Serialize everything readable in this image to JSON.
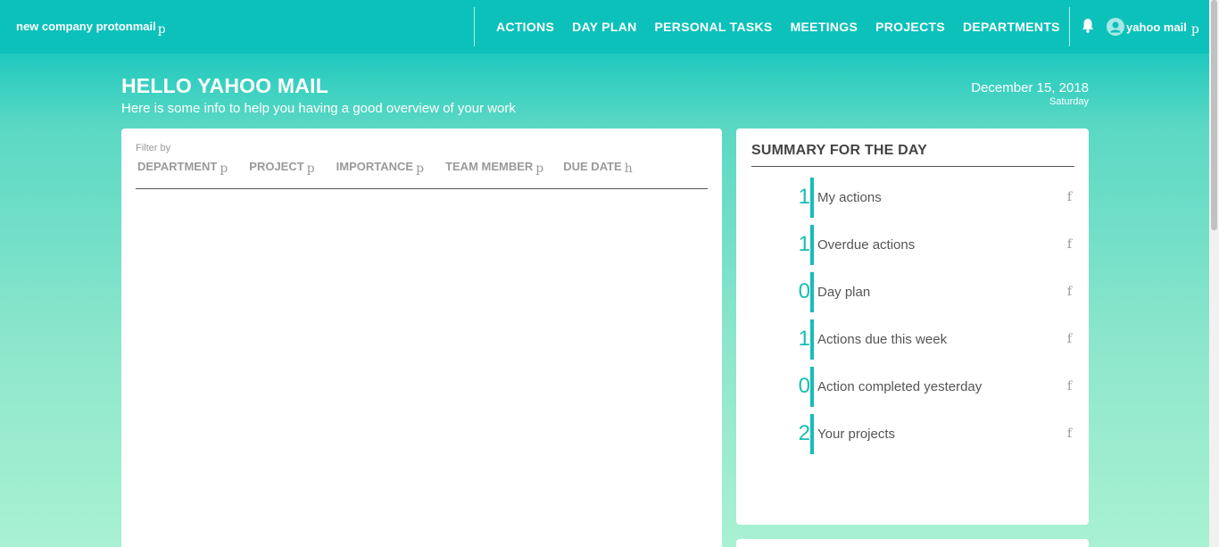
{
  "topbar": {
    "company": "new company protonmail",
    "company_glyph": "p",
    "nav": [
      "ACTIONS",
      "DAY PLAN",
      "PERSONAL TASKS",
      "MEETINGS",
      "PROJECTS",
      "DEPARTMENTS"
    ],
    "user_name": "yahoo mail",
    "user_glyph": "p"
  },
  "greeting": {
    "title": "HELLO YAHOO MAIL",
    "subtitle": "Here is some info to help you having a good overview of your work",
    "date": "December 15, 2018",
    "day": "Saturday"
  },
  "filters": {
    "label": "Filter by",
    "items": [
      {
        "label": "DEPARTMENT",
        "glyph": "p"
      },
      {
        "label": "PROJECT",
        "glyph": "p"
      },
      {
        "label": "IMPORTANCE",
        "glyph": "p"
      },
      {
        "label": "TEAM MEMBER",
        "glyph": "p"
      },
      {
        "label": "DUE DATE",
        "glyph": "h"
      }
    ]
  },
  "summary": {
    "title": "SUMMARY FOR THE DAY",
    "items": [
      {
        "count": "1",
        "label": "My actions",
        "glyph": "f"
      },
      {
        "count": "1",
        "label": "Overdue actions",
        "glyph": "f"
      },
      {
        "count": "0",
        "label": "Day plan",
        "glyph": "f"
      },
      {
        "count": "1",
        "label": "Actions due this week",
        "glyph": "f"
      },
      {
        "count": "0",
        "label": "Action completed yesterday",
        "glyph": "f"
      },
      {
        "count": "2",
        "label": "Your projects",
        "glyph": "f"
      }
    ]
  },
  "colors": {
    "accent": "#17bdb5",
    "topbar": "#0cc1ba"
  }
}
